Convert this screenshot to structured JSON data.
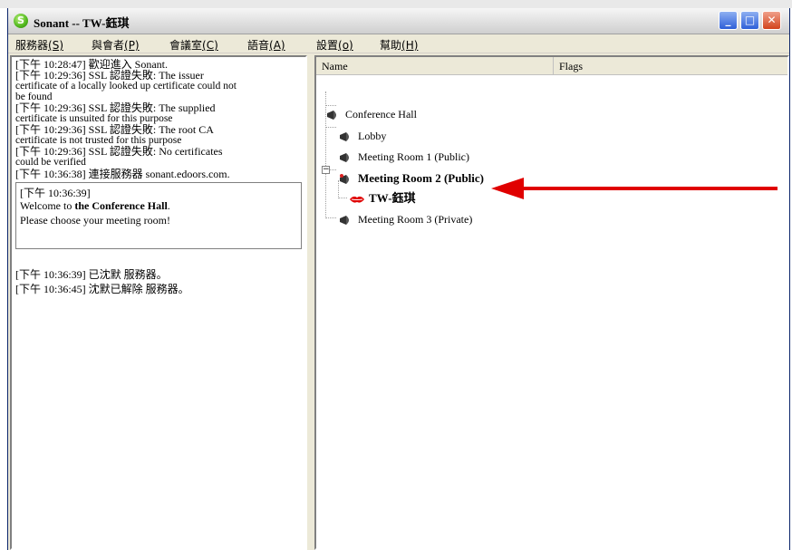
{
  "window": {
    "title": "Sonant -- TW-鈺琪"
  },
  "window_controls": {
    "minimize": "_",
    "maximize": "□",
    "close": "✕"
  },
  "menu": [
    {
      "text": "服務器",
      "key": "(S)"
    },
    {
      "text": "與會者",
      "key": "(P)"
    },
    {
      "text": "會議室",
      "key": "(C)"
    },
    {
      "text": "語音",
      "key": "(A)"
    },
    {
      "text": "設置",
      "key": "(o)"
    },
    {
      "text": "幫助",
      "key": "(H)"
    }
  ],
  "log": {
    "lines": [
      "[下午 10:28:47] 歡迎進入 Sonant.",
      "[下午 10:29:36] SSL 認證失敗: The issuer",
      "certificate of a locally looked up certificate could not",
      "be found",
      "[下午 10:29:36] SSL 認證失敗: The supplied",
      "certificate is unsuited for this purpose",
      "[下午 10:29:36] SSL 認證失敗: The root CA",
      "certificate is not trusted for this purpose",
      "[下午 10:29:36] SSL 認證失敗: No certificates",
      "could be verified",
      "[下午 10:36:38] 連接服務器 sonant.edoors.com."
    ],
    "message": {
      "time": "[下午 10:36:39]",
      "welcome_prefix": "Welcome to ",
      "welcome_bold": "the Conference Hall",
      "welcome_suffix": ".",
      "line3": "Please choose your meeting room!"
    },
    "after_lines": [
      "[下午 10:36:39] 已沈默 服務器。",
      "[下午 10:36:45] 沈默已解除 服務器。"
    ]
  },
  "tree": {
    "columns": {
      "name": "Name",
      "flags": "Flags"
    },
    "root": "Conference Hall",
    "rooms": [
      "Lobby",
      "Meeting Room 1 (Public)",
      "Meeting Room 2 (Public)",
      "Meeting Room 3 (Private)"
    ],
    "user": "TW-鈺琪",
    "expander": "−"
  },
  "colors": {
    "arrow": "#e00000",
    "close_button": "#d2441d",
    "title_blue": "#2e5fd8"
  },
  "icons": {
    "app": "sonant-logo-icon",
    "room": "megaphone-icon",
    "user": "lips-icon"
  }
}
